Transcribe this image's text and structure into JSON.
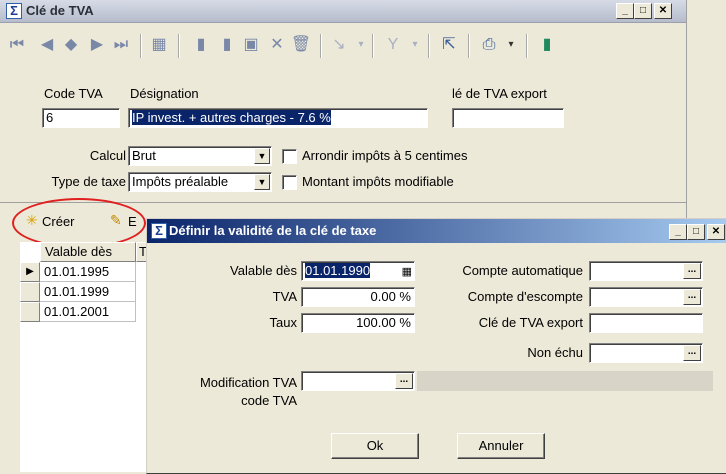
{
  "main_window": {
    "title": "Clé de TVA",
    "min": "_",
    "max": "□",
    "close": "✕"
  },
  "toolbar": {
    "icons": [
      "first-icon",
      "prev-icon",
      "diamond-icon",
      "next-icon",
      "last-icon",
      "table-icon",
      "new-icon",
      "copy-icon",
      "save-icon",
      "delete-icon",
      "trash-icon",
      "tools-icon",
      "filter-icon",
      "cursor-icon",
      "print-icon",
      "exit-icon"
    ]
  },
  "form": {
    "code_label": "Code TVA",
    "code_value": "6",
    "designation_label": "Désignation",
    "designation_value": "IP invest. + autres charges - 7.6 %",
    "export_label": "lé de TVA export",
    "export_value": "",
    "calcul_label": "Calcul",
    "calcul_value": "Brut",
    "type_label": "Type de taxe",
    "type_value": "Impôts préalable",
    "arrondir_label": "Arrondir impôts à 5 centimes",
    "montant_label": "Montant impôts modifiable"
  },
  "grid_toolbar": {
    "create_label": "Créer",
    "edit_label": "E"
  },
  "grid": {
    "header": "Valable dès",
    "header2": "T",
    "rows": [
      "01.01.1995",
      "01.01.1999",
      "01.01.2001"
    ],
    "current_marker": "▶"
  },
  "dialog": {
    "title": "Définir la validité de la clé de taxe",
    "min": "_",
    "max": "□",
    "close": "✕",
    "valable_label": "Valable dès",
    "valable_value": "01.01.1990",
    "tva_label": "TVA",
    "tva_value": "0.00 %",
    "taux_label": "Taux",
    "taux_value": "100.00 %",
    "compte_auto_label": "Compte automatique",
    "compte_esc_label": "Compte d'escompte",
    "cle_export_label": "Clé de TVA export",
    "non_echu_label": "Non échu",
    "modif_label_1": "Modification TVA",
    "modif_label_2": "code TVA",
    "ok_label": "Ok",
    "annuler_label": "Annuler",
    "ellipsis": "..."
  }
}
